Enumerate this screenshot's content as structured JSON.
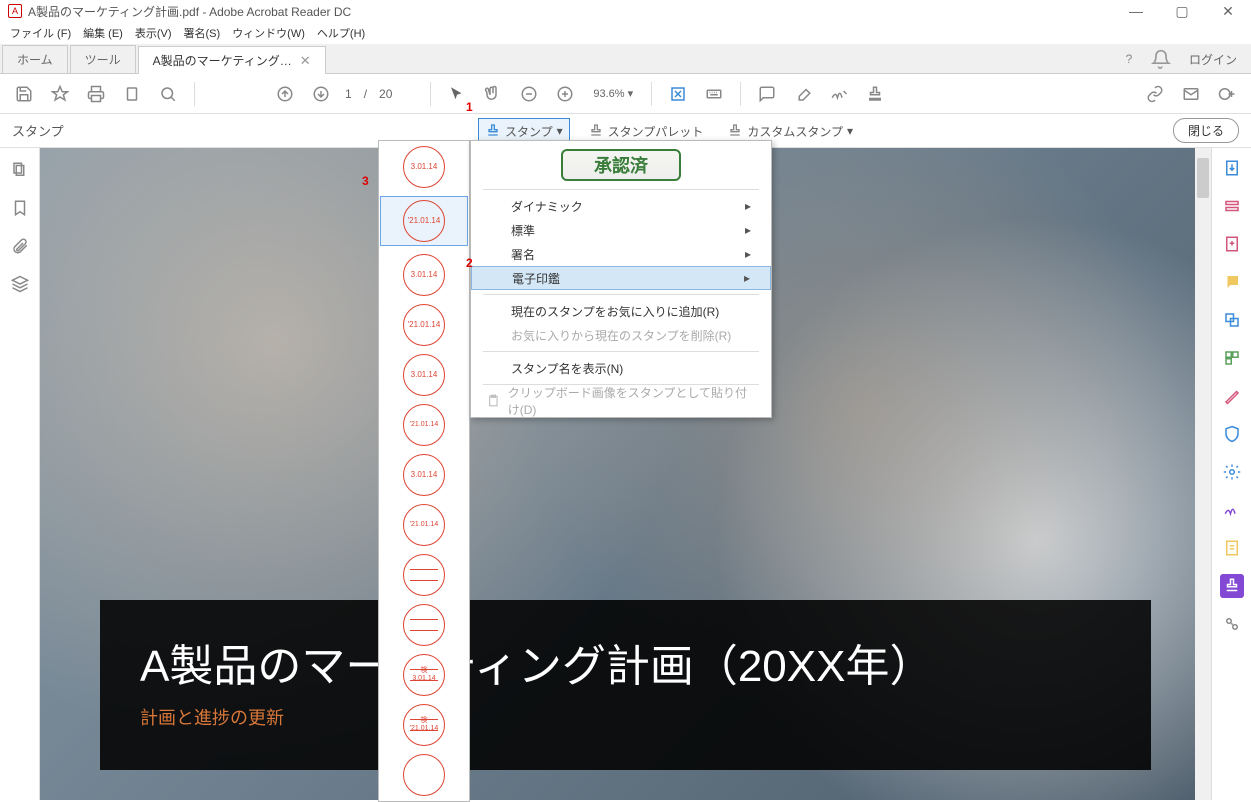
{
  "titlebar": {
    "filename": "A製品のマーケティング計画.pdf",
    "app": "Adobe Acrobat Reader DC"
  },
  "menubar": {
    "file": "ファイル (F)",
    "edit": "編集 (E)",
    "view": "表示(V)",
    "sign": "署名(S)",
    "window": "ウィンドウ(W)",
    "help": "ヘルプ(H)"
  },
  "tabs": {
    "home": "ホーム",
    "tool": "ツール",
    "doc": "A製品のマーケティング…",
    "login": "ログイン"
  },
  "toolbar": {
    "page_cur": "1",
    "page_sep": "/",
    "page_total": "20",
    "zoom": "93.6%"
  },
  "subbar": {
    "label": "スタンプ",
    "stamp": "スタンプ",
    "palette": "スタンプパレット",
    "custom": "カスタムスタンプ",
    "close": "閉じる"
  },
  "doc": {
    "title": "A製品のマーケティング計画（20XX年）",
    "subtitle": "計画と進捗の更新"
  },
  "menu": {
    "approved": "承認済",
    "dynamic": "ダイナミック",
    "standard": "標準",
    "sign": "署名",
    "eseal": "電子印鑑",
    "add_fav": "現在のスタンプをお気に入りに追加(R)",
    "del_fav": "お気に入りから現在のスタンプを削除(R)",
    "show_name": "スタンプ名を表示(N)",
    "clip": "クリップボード画像をスタンプとして貼り付け(D)"
  },
  "stamps": {
    "d1": "3.01.14",
    "d2": "'21.01.14",
    "d3": "3.01.14",
    "d4": "'21.01.14",
    "d5": "3.01.14",
    "d6": "'21.01.14",
    "d7": "3.01.14",
    "d8": "'21.01.14",
    "k1_top": "検",
    "k1_bot": "3.01.14",
    "k2_top": "検",
    "k2_bot": "'21.01.14"
  },
  "markers": {
    "m1": "1",
    "m2": "2",
    "m3": "3"
  }
}
